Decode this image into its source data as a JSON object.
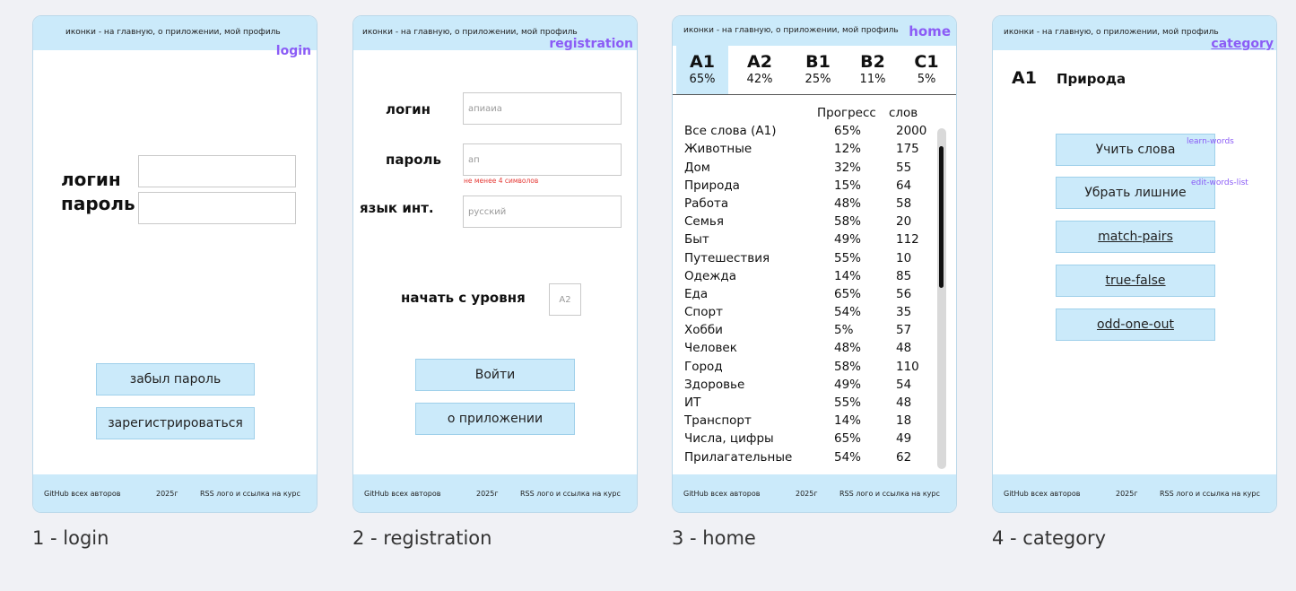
{
  "common": {
    "header_text": "иконки - на главную, о приложении, мой профиль",
    "footer_github": "GitHub всех авторов",
    "footer_year": "2025г",
    "footer_rss": "RSS лого и ссылка на курс"
  },
  "login": {
    "tag": "login",
    "login_label": "логин",
    "password_label": "пароль",
    "forgot_button": "забыл пароль",
    "register_button": "зарегистрироваться",
    "caption": "1 - login"
  },
  "registration": {
    "tag": "registration",
    "login_label": "логин",
    "login_value": "апиаиа",
    "password_label": "пароль",
    "password_value": "ап",
    "password_error": "не менее 4 символов",
    "lang_label": "язык инт.",
    "lang_value": "русский",
    "level_label": "начать с уровня",
    "level_value": "A2",
    "enter_button": "Войти",
    "about_button": "о приложении",
    "caption": "2 - registration"
  },
  "home": {
    "tag": "home",
    "levels": [
      {
        "code": "A1",
        "pct": "65%"
      },
      {
        "code": "A2",
        "pct": "42%"
      },
      {
        "code": "B1",
        "pct": "25%"
      },
      {
        "code": "B2",
        "pct": "11%"
      },
      {
        "code": "C1",
        "pct": "5%"
      }
    ],
    "col_progress": "Прогресс",
    "col_words": "слов",
    "rows": [
      {
        "name": "Все слова (A1)",
        "progress": "65%",
        "words": "2000"
      },
      {
        "name": "Животные",
        "progress": "12%",
        "words": "175"
      },
      {
        "name": "Дом",
        "progress": "32%",
        "words": "55"
      },
      {
        "name": "Природа",
        "progress": "15%",
        "words": "64"
      },
      {
        "name": "Работа",
        "progress": "48%",
        "words": "58"
      },
      {
        "name": "Семья",
        "progress": "58%",
        "words": "20"
      },
      {
        "name": "Быт",
        "progress": "49%",
        "words": "112"
      },
      {
        "name": "Путешествия",
        "progress": "55%",
        "words": "10"
      },
      {
        "name": "Одежда",
        "progress": "14%",
        "words": "85"
      },
      {
        "name": "Еда",
        "progress": "65%",
        "words": "56"
      },
      {
        "name": "Спорт",
        "progress": "54%",
        "words": "35"
      },
      {
        "name": "Хобби",
        "progress": "5%",
        "words": "57"
      },
      {
        "name": "Человек",
        "progress": "48%",
        "words": "48"
      },
      {
        "name": "Город",
        "progress": "58%",
        "words": "110"
      },
      {
        "name": "Здоровье",
        "progress": "49%",
        "words": "54"
      },
      {
        "name": "ИТ",
        "progress": "55%",
        "words": "48"
      },
      {
        "name": "Транспорт",
        "progress": "14%",
        "words": "18"
      },
      {
        "name": "Числа, цифры",
        "progress": "65%",
        "words": "49"
      },
      {
        "name": "Прилагательные",
        "progress": "54%",
        "words": "62"
      }
    ],
    "caption": "3 - home"
  },
  "category": {
    "tag": "category",
    "level": "A1",
    "title": "Природа",
    "learn_button": "Учить слова",
    "learn_tag": "learn-words",
    "edit_button": "Убрать лишние",
    "edit_tag": "edit-words-list",
    "match_button": "match-pairs",
    "truefalse_button": "true-false",
    "oddone_button": "odd-one-out",
    "caption": "4 - category"
  }
}
